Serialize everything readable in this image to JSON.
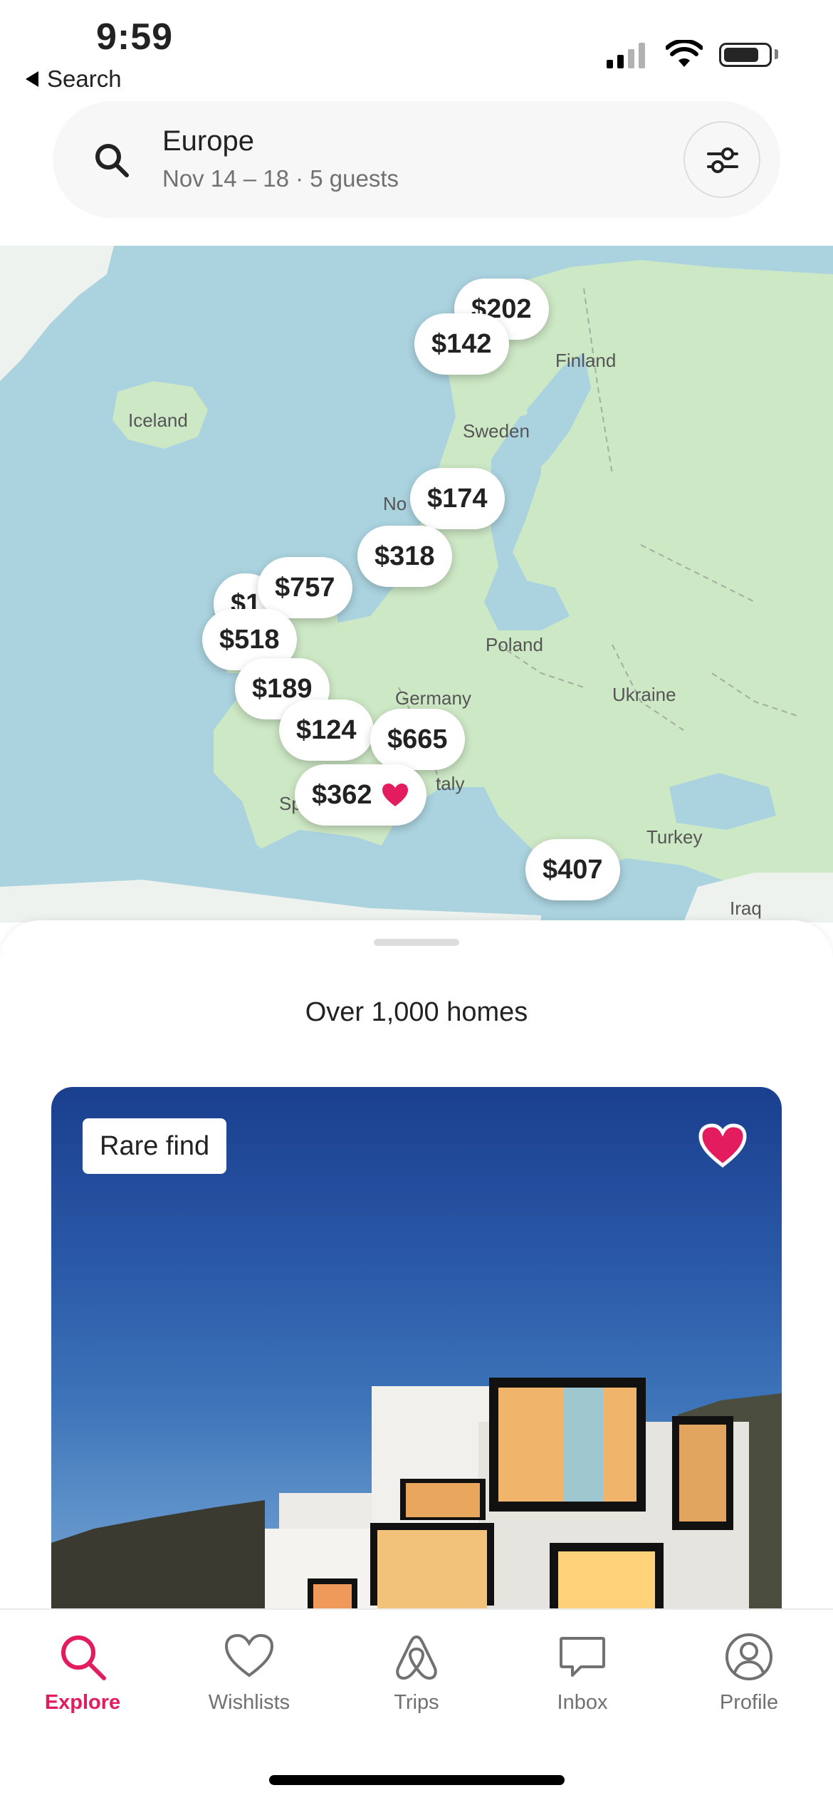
{
  "status_bar": {
    "time": "9:59",
    "back_label": "Search"
  },
  "search": {
    "title": "Europe",
    "subtitle": "Nov 14 – 18 · 5 guests"
  },
  "map": {
    "labels": [
      "Iceland",
      "Finland",
      "Sweden",
      "No",
      "Poland",
      "Germany",
      "Ukraine",
      "Sp",
      "taly",
      "Turkey",
      "Iraq"
    ],
    "price_pins": [
      {
        "price": "$202"
      },
      {
        "price": "$142"
      },
      {
        "price": "$174"
      },
      {
        "price": "$318"
      },
      {
        "price": "$1"
      },
      {
        "price": "$757"
      },
      {
        "price": "$518"
      },
      {
        "price": "$189"
      },
      {
        "price": "$124"
      },
      {
        "price": "$665"
      },
      {
        "price": "$362",
        "favorited": true
      },
      {
        "price": "$407"
      }
    ]
  },
  "sheet": {
    "homes_count": "Over 1,000 homes"
  },
  "listing": {
    "badge": "Rare find",
    "favorited": true
  },
  "tabs": [
    {
      "label": "Explore",
      "icon": "search-icon",
      "active": true
    },
    {
      "label": "Wishlists",
      "icon": "heart-icon",
      "active": false
    },
    {
      "label": "Trips",
      "icon": "airbnb-logo-icon",
      "active": false
    },
    {
      "label": "Inbox",
      "icon": "message-icon",
      "active": false
    },
    {
      "label": "Profile",
      "icon": "profile-icon",
      "active": false
    }
  ],
  "colors": {
    "accent": "#e31c5f",
    "text": "#222222",
    "muted": "#717171",
    "water": "#aad3df",
    "land": "#cde8c5"
  }
}
